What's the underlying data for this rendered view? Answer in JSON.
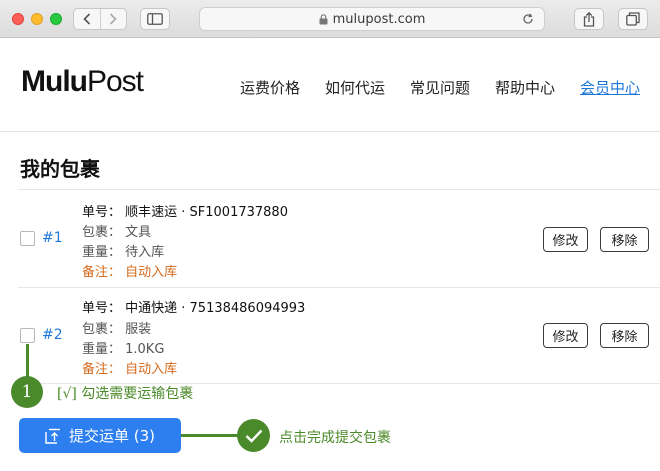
{
  "browser": {
    "url": "mulupost.com",
    "icons": [
      "back-icon",
      "forward-icon",
      "sidebar-icon",
      "lock-icon",
      "reload-icon",
      "share-icon",
      "tabs-icon"
    ]
  },
  "site": {
    "logo_bold": "Mulu",
    "logo_light": "Post",
    "nav": [
      {
        "label": "运费价格"
      },
      {
        "label": "如何代运"
      },
      {
        "label": "常见问题"
      },
      {
        "label": "帮助中心"
      },
      {
        "label": "会员中心",
        "active": true
      }
    ]
  },
  "section_title": "我的包裹",
  "packages": [
    {
      "number": "#1",
      "tracking": "单号： 顺丰速运 · SF1001737880",
      "content": "包裹： 文具",
      "weight": "重量： 待入库",
      "note": "备注： 自动入库",
      "edit_label": "修改",
      "remove_label": "移除"
    },
    {
      "number": "#2",
      "tracking": "单号： 中通快递 · 75138486094993",
      "content": "包裹： 服装",
      "weight": "重量： 1.0KG",
      "note": "备注： 自动入库",
      "edit_label": "修改",
      "remove_label": "移除"
    }
  ],
  "annotations": {
    "step_number": "1",
    "step_hint": "[√] 勾选需要运输包裹",
    "done_hint": "点击完成提交包裹",
    "color": "#4b8a2a"
  },
  "submit_label": "提交运单 (3)",
  "colors": {
    "accent": "#2d7ff0",
    "link": "#1e78d7",
    "note": "#d46a1c"
  }
}
